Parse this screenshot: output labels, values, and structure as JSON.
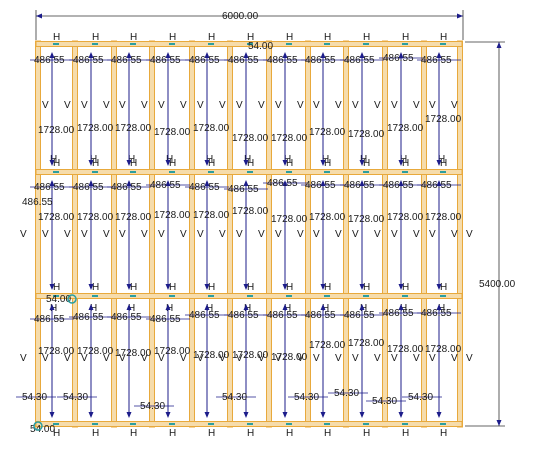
{
  "dimensions": {
    "total_width": "6000.00",
    "total_height": "5400.00",
    "stud_length": "1728.00",
    "spacing": "486.55",
    "offset_small": "54.00",
    "offset_block": "54.30"
  },
  "markers": {
    "horizontal": "H",
    "vertical": "V"
  },
  "colors": {
    "frame_fill": "#f6dcab",
    "frame_stroke": "#e8a93c",
    "dimension_line": "#1c1c8a",
    "text": "#1a1a1a",
    "handle": "#2a9ea0"
  }
}
